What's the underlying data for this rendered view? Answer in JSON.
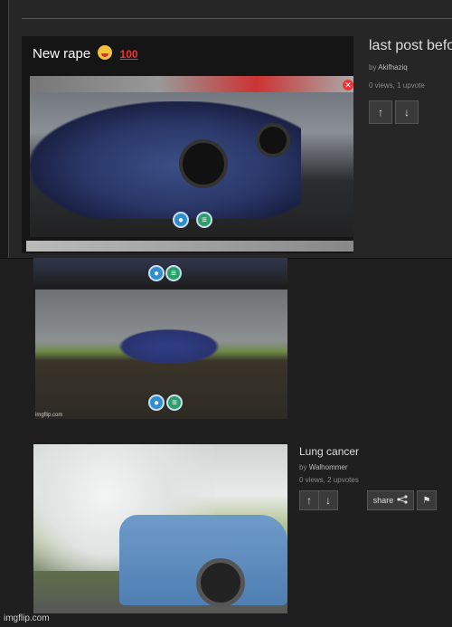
{
  "post1": {
    "title": "New rape",
    "emoji_face": "😝",
    "emoji_hundred": "100",
    "overlay_buttons": [
      "share-icon",
      "settings-icon"
    ]
  },
  "side_post_top": {
    "title": "last post befo",
    "by_prefix": "by",
    "author": "Akifhaziq",
    "stats": "0 views, 1 upvote",
    "upvote_icon": "↑",
    "downvote_icon": "↓"
  },
  "post2": {
    "watermark": "imgflip.com",
    "overlay_buttons": [
      "share-icon",
      "settings-icon"
    ]
  },
  "post3": {
    "title": "Lung cancer",
    "by_prefix": "by",
    "author": "Walhommer",
    "stats": "0 views, 2 upvotes",
    "share_label": "share",
    "upvote_icon": "↑",
    "downvote_icon": "↓",
    "flag_icon": "⚑"
  },
  "footer": {
    "watermark": "imgflip.com"
  },
  "colors": {
    "page_bg": "#1f1f1f",
    "panel_bg": "#262626",
    "accent_blue": "#2d8fd1",
    "accent_green": "#2aa06a"
  }
}
